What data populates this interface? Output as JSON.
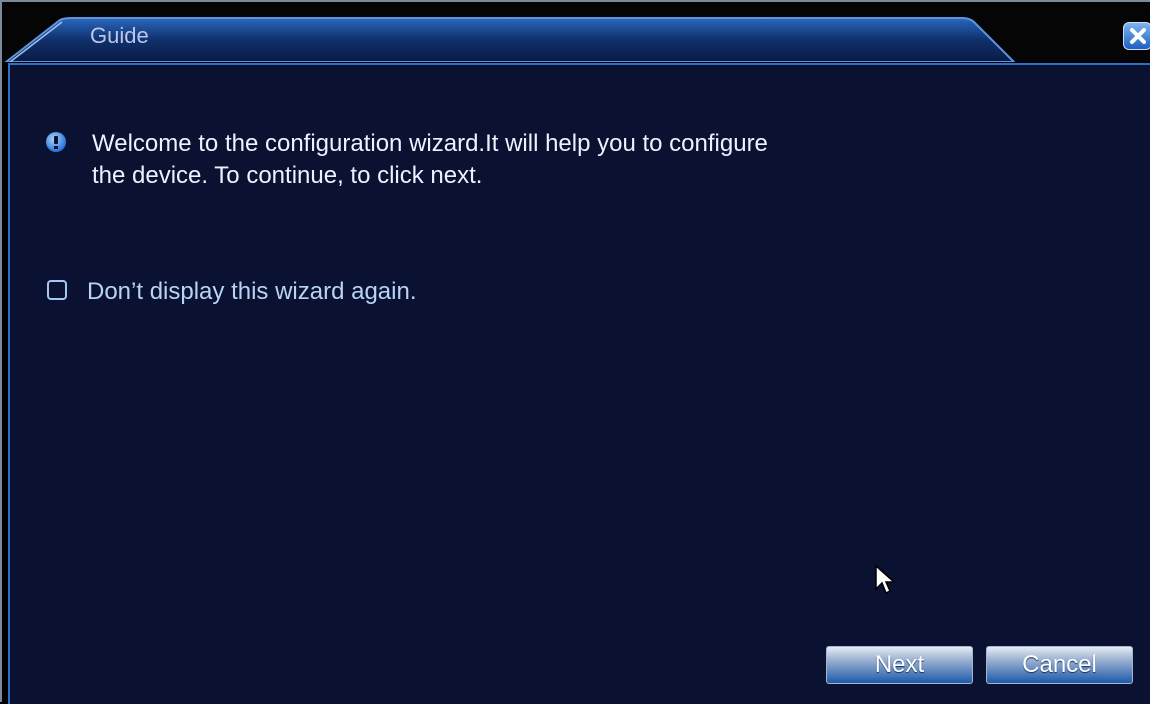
{
  "window": {
    "title": "Guide"
  },
  "message": {
    "line1": "Welcome to the configuration wizard.It will help you to configure",
    "line2": "the device. To continue, to click next."
  },
  "option": {
    "label": "Don’t display this wizard again.",
    "checked": false
  },
  "buttons": {
    "next_label": "Next",
    "cancel_label": "Cancel"
  },
  "icons": {
    "info": "info-icon",
    "close": "close-icon",
    "cursor": "mouse-pointer-icon"
  },
  "colors": {
    "panel_bg": "#0a1131",
    "accent": "#2f6fc7",
    "title_text": "#b8c8ec"
  }
}
